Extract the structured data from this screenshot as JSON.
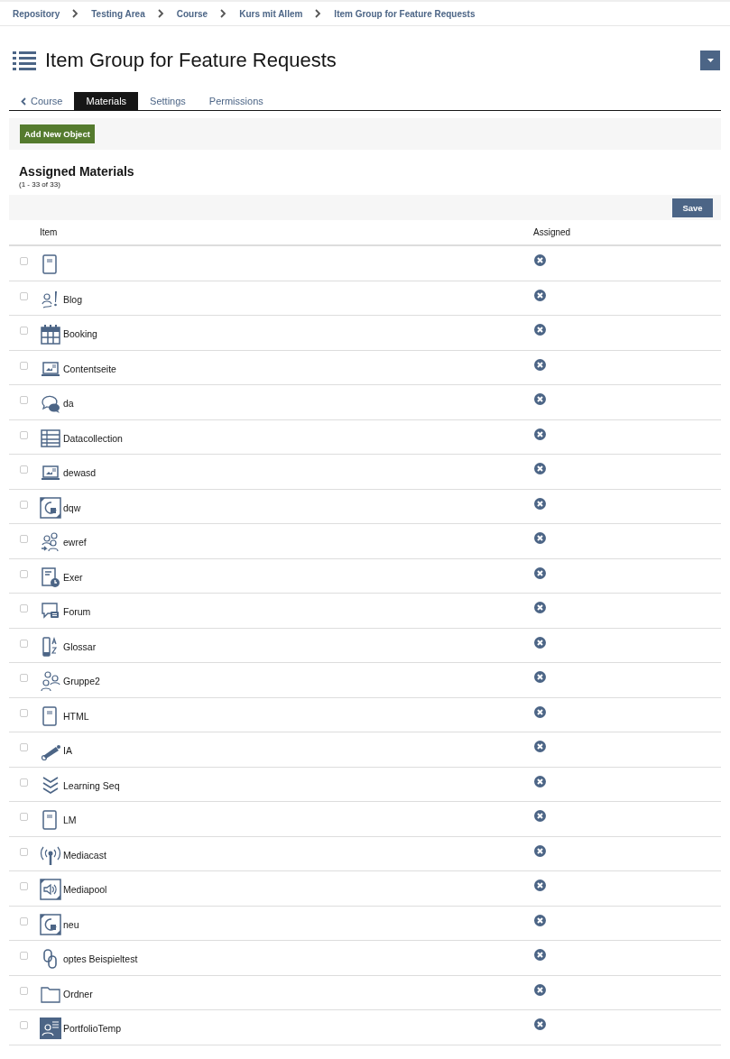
{
  "breadcrumbs": [
    "Repository",
    "Testing Area",
    "Course",
    "Kurs mit Allem",
    "Item Group for Feature Requests"
  ],
  "title": "Item Group for Feature Requests",
  "tabs": [
    {
      "label": "Course",
      "kind": "back",
      "selected": false
    },
    {
      "label": "Materials",
      "kind": "tab",
      "selected": true
    },
    {
      "label": "Settings",
      "kind": "tab",
      "selected": false
    },
    {
      "label": "Permissions",
      "kind": "tab",
      "selected": false
    }
  ],
  "toolbar": {
    "button": "Add New Object"
  },
  "section": {
    "title": "Assigned Materials",
    "count": "(1 - 33 of 33)",
    "save_button": "Save"
  },
  "table": {
    "columns": [
      "Item",
      "Assigned"
    ],
    "rows": [
      {
        "kind": "page",
        "label": "",
        "checked": false,
        "assigned": false
      },
      {
        "kind": "blog",
        "label": "Blog",
        "checked": false,
        "assigned": false
      },
      {
        "kind": "calendar",
        "label": "Booking",
        "checked": false,
        "assigned": false
      },
      {
        "kind": "laptop",
        "label": "Contentseite",
        "checked": false,
        "assigned": false
      },
      {
        "kind": "chat",
        "label": "da",
        "checked": false,
        "assigned": false
      },
      {
        "kind": "table",
        "label": "Datacollection",
        "checked": false,
        "assigned": false
      },
      {
        "kind": "laptop",
        "label": "dewasd",
        "checked": false,
        "assigned": false
      },
      {
        "kind": "survey",
        "label": "dqw",
        "checked": false,
        "assigned": false
      },
      {
        "kind": "group-arrow",
        "label": "ewref",
        "checked": false,
        "assigned": false
      },
      {
        "kind": "exercise",
        "label": "Exer",
        "checked": false,
        "assigned": false
      },
      {
        "kind": "forum",
        "label": "Forum",
        "checked": false,
        "assigned": false
      },
      {
        "kind": "glossary",
        "label": "Glossar",
        "checked": false,
        "assigned": false
      },
      {
        "kind": "group",
        "label": "Gruppe2",
        "checked": false,
        "assigned": false
      },
      {
        "kind": "page",
        "label": "HTML",
        "checked": false,
        "assigned": false
      },
      {
        "kind": "telescope",
        "label": "IA",
        "checked": false,
        "assigned": false
      },
      {
        "kind": "chevrons",
        "label": "Learning Seq",
        "checked": false,
        "assigned": false
      },
      {
        "kind": "page",
        "label": "LM",
        "checked": false,
        "assigned": false
      },
      {
        "kind": "broadcast",
        "label": "Mediacast",
        "checked": false,
        "assigned": false
      },
      {
        "kind": "speaker",
        "label": "Mediapool",
        "checked": false,
        "assigned": false
      },
      {
        "kind": "survey",
        "label": "neu",
        "checked": false,
        "assigned": false
      },
      {
        "kind": "links",
        "label": "optes Beispieltest",
        "checked": false,
        "assigned": false
      },
      {
        "kind": "folder",
        "label": "Ordner",
        "checked": false,
        "assigned": false
      },
      {
        "kind": "portfolio",
        "label": "PortfolioTemp",
        "checked": false,
        "assigned": false
      }
    ]
  }
}
